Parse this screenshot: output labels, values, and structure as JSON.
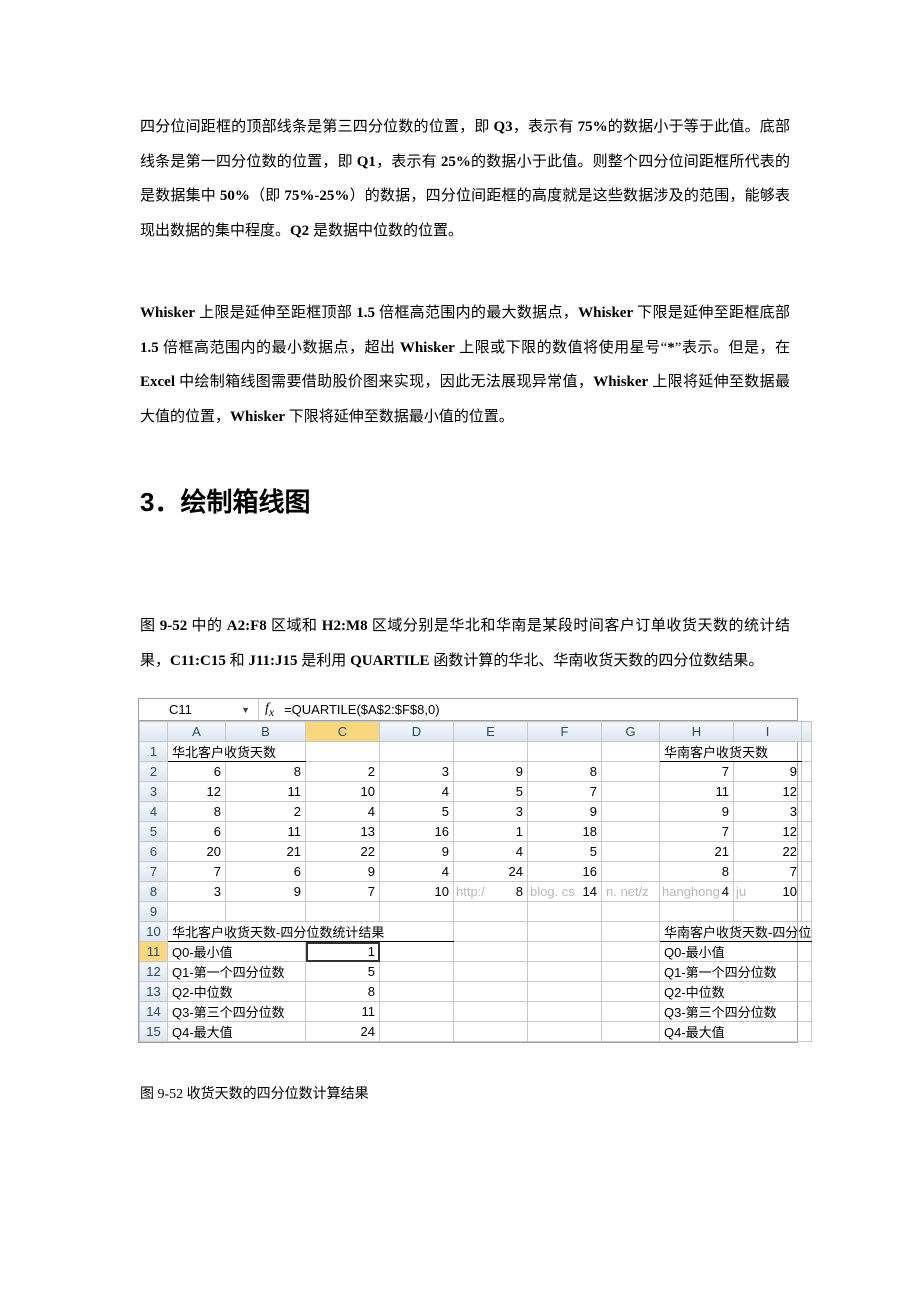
{
  "para1_pre": "四分位间距框的顶部线条是第三四分位数的位置，即 ",
  "q3": "Q3",
  "para1_mid1": "，表示有 ",
  "pct75": "75%",
  "para1_mid2": "的数据小于等于此值。底部线条是第一四分位数的位置，即 ",
  "q1": "Q1",
  "para1_mid3": "，表示有 ",
  "pct25": "25%",
  "para1_mid4": "的数据小于此值。则整个四分位间距框所代表的是数据集中 ",
  "pct50": "50%",
  "para1_mid5": "（即 ",
  "pct_diff": "75%-25%",
  "para1_mid6": "）的数据，四分位间距框的高度就是这些数据涉及的范围，能够表现出数据的集中程度。",
  "q2": "Q2",
  "para1_tail": " 是数据中位数的位置。",
  "para2_w1": "Whisker",
  "para2_a": " 上限是延伸至距框顶部 ",
  "m15a": "1.5",
  "para2_b": " 倍框高范围内的最大数据点，",
  "para2_c": " 下限是延伸至距框底部 ",
  "m15b": "1.5",
  "para2_d": " 倍框高范围内的最小数据点，超出 ",
  "para2_e": " 上限或下限的数值将使用星号“",
  "star": "*",
  "para2_f": "”表示。但是，在 ",
  "excel": "Excel",
  "para2_g": " 中绘制箱线图需要借助股价图来实现，因此无法展现异常值，",
  "para2_h": " 上限将延伸至数据最大值的位置，",
  "para2_i": " 下限将延伸至数据最小值的位置。",
  "heading": "3．绘制箱线图",
  "para3_a": "图 ",
  "fig952": "9-52",
  "para3_b": " 中的 ",
  "rangeA": "A2:F8",
  "para3_c": " 区域和 ",
  "rangeH": "H2:M8",
  "para3_d": " 区域分别是华北和华南是某段时间客户订单收货天数的统计结果，",
  "rangeC": "C11:C15",
  "para3_e": " 和 ",
  "rangeJ": "J11:J15",
  "para3_f": " 是利用 ",
  "quartile": "QUARTILE",
  "para3_g": " 函数计算的华北、华南收货天数的四分位数结果。",
  "namebox": "C11",
  "formula": "=QUARTILE($A$2:$F$8,0)",
  "cols": [
    "A",
    "B",
    "C",
    "D",
    "E",
    "F",
    "G",
    "H",
    "I"
  ],
  "r1": {
    "A": "华北客户收货天数",
    "H": "华南客户收货天数"
  },
  "r2": {
    "A": "6",
    "B": "8",
    "C": "2",
    "D": "3",
    "E": "9",
    "F": "8",
    "H": "7",
    "I": "9"
  },
  "r3": {
    "A": "12",
    "B": "11",
    "C": "10",
    "D": "4",
    "E": "5",
    "F": "7",
    "H": "11",
    "I": "12"
  },
  "r4": {
    "A": "8",
    "B": "2",
    "C": "4",
    "D": "5",
    "E": "3",
    "F": "9",
    "H": "9",
    "I": "3"
  },
  "r5": {
    "A": "6",
    "B": "11",
    "C": "13",
    "D": "16",
    "E": "1",
    "F": "18",
    "H": "7",
    "I": "12"
  },
  "r6": {
    "A": "20",
    "B": "21",
    "C": "22",
    "D": "9",
    "E": "4",
    "F": "5",
    "H": "21",
    "I": "22"
  },
  "r7": {
    "A": "7",
    "B": "6",
    "C": "9",
    "D": "4",
    "E": "24",
    "F": "16",
    "H": "8",
    "I": "7"
  },
  "r8": {
    "A": "3",
    "B": "9",
    "C": "7",
    "D": "10",
    "E": "8",
    "F": "14",
    "H": "4",
    "I": "10"
  },
  "r8_watermark_left": "http:/",
  "r8_watermark_mid": "blog. cs",
  "r8_watermark_g": "n. net/z",
  "r8_watermark_h": "hanghong",
  "r8_watermark_i": "ju",
  "r10": {
    "A": "华北客户收货天数-四分位数统计结果",
    "H": "华南客户收货天数-四分位"
  },
  "r11": {
    "A": "Q0-最小值",
    "C": "1",
    "H": "Q0-最小值"
  },
  "r12": {
    "A": "Q1-第一个四分位数",
    "C": "5",
    "H": "Q1-第一个四分位数"
  },
  "r13": {
    "A": "Q2-中位数",
    "C": "8",
    "H": "Q2-中位数"
  },
  "r14": {
    "A": "Q3-第三个四分位数",
    "C": "11",
    "H": "Q3-第三个四分位数"
  },
  "r15": {
    "A": "Q4-最大值",
    "C": "24",
    "H": "Q4-最大值"
  },
  "caption": "图 9-52 收货天数的四分位数计算结果"
}
